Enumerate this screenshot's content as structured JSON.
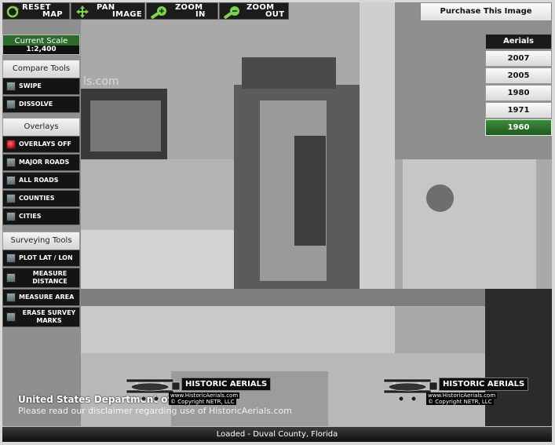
{
  "toolbar": {
    "reset": [
      "RESET",
      "MAP"
    ],
    "pan": [
      "PAN",
      "IMAGE"
    ],
    "zoom_in": [
      "ZOOM",
      "IN"
    ],
    "zoom_out": [
      "ZOOM",
      "OUT"
    ]
  },
  "scale": {
    "title": "Current Scale",
    "value": "1:2,400"
  },
  "compare_tools": {
    "header": "Compare Tools",
    "items": [
      "SWIPE",
      "DISSOLVE"
    ]
  },
  "overlays": {
    "header": "Overlays",
    "items": [
      "OVERLAYS OFF",
      "MAJOR ROADS",
      "ALL ROADS",
      "COUNTIES",
      "CITIES"
    ],
    "active_item": "OVERLAYS OFF"
  },
  "surveying_tools": {
    "header": "Surveying Tools",
    "items": [
      "PLOT LAT / LON",
      "MEASURE DISTANCE",
      "MEASURE AREA",
      "ERASE SURVEY MARKS"
    ]
  },
  "purchase_label": "Purchase This Image",
  "aerials": {
    "header": "Aerials",
    "years": [
      "2007",
      "2005",
      "1980",
      "1971",
      "1960"
    ],
    "selected": "1960"
  },
  "map": {
    "watermark": "ls.com",
    "credit_title": "United States Department of Agriculture",
    "disclaimer": "Please read our disclaimer regarding use of HistoricAerials.com"
  },
  "brand": {
    "name": "HISTORIC AERIALS",
    "url": "www.HistoricAerials.com",
    "copyright": "© Copyright NETR, LLC"
  },
  "status": "Loaded - Duval County, Florida",
  "colors": {
    "accent_green": "#2d6b2d",
    "panel_dark": "#141414",
    "overlay_active": "#d01010"
  }
}
